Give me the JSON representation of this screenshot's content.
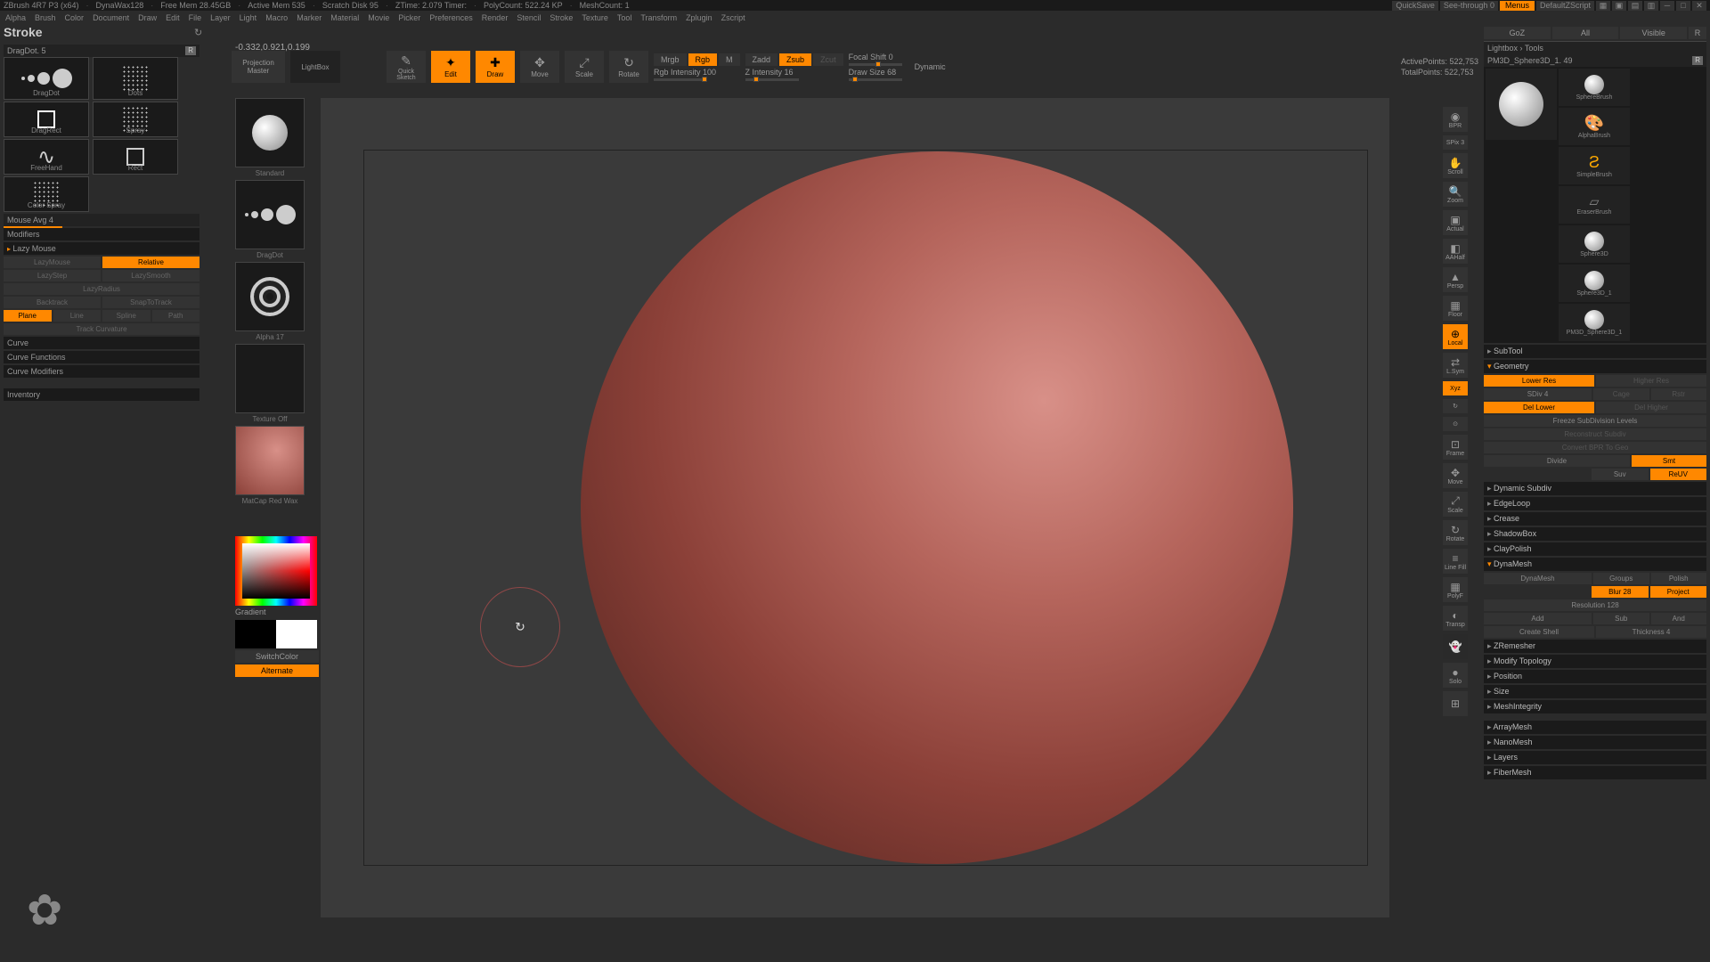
{
  "titlebar": {
    "app": "ZBrush 4R7 P3 (x64)",
    "stats": [
      "DynaWax128",
      "Free Mem 28.45GB",
      "Active Mem 535",
      "Scratch Disk 95",
      "ZTime: 2.079 Timer:",
      "PolyCount: 522.24 KP",
      "MeshCount: 1"
    ],
    "quicksave": "QuickSave",
    "seethrough": "See-through 0",
    "menus": "Menus",
    "layout": "DefaultZScript"
  },
  "menubar": [
    "Alpha",
    "Brush",
    "Color",
    "Document",
    "Draw",
    "Edit",
    "File",
    "Layer",
    "Light",
    "Macro",
    "Marker",
    "Material",
    "Movie",
    "Picker",
    "Preferences",
    "Render",
    "Stencil",
    "Stroke",
    "Texture",
    "Tool",
    "Transform",
    "Zplugin",
    "Zscript"
  ],
  "stroke_title": "Stroke",
  "coord": "-0.332,0.921,0.199",
  "left": {
    "brush_name": "DragDot. 5",
    "r": "R",
    "strokes": [
      {
        "name": "DragDot"
      },
      {
        "name": "Dots"
      },
      {
        "name": "DragRect"
      },
      {
        "name": "Spray"
      },
      {
        "name": "FreeHand"
      },
      {
        "name": "Rect"
      },
      {
        "name": "Color Spray"
      }
    ],
    "mouse_avg": "Mouse Avg 4",
    "modifiers": "Modifiers",
    "lazy_mouse": "Lazy Mouse",
    "lazymouse": "LazyMouse",
    "relative": "Relative",
    "lazystep": "LazyStep",
    "lazysmooth": "LazySmooth",
    "lazyradius": "LazyRadius",
    "backtrack": "Backtrack",
    "snaptotrack": "SnapToTrack",
    "track_opts": [
      "Plane",
      "Line",
      "Spline",
      "Path"
    ],
    "track_curv": "Track Curvature",
    "curve": "Curve",
    "curve_func": "Curve Functions",
    "curve_mod": "Curve Modifiers",
    "inventory": "Inventory"
  },
  "toolbar": {
    "proj_master": "Projection\nMaster",
    "lightbox": "LightBox",
    "quick_sketch": "Quick\nSketch",
    "edit": "Edit",
    "draw": "Draw",
    "move": "Move",
    "scale": "Scale",
    "rotate": "Rotate",
    "mrgb": "Mrgb",
    "rgb": "Rgb",
    "m": "M",
    "rgb_int": "Rgb Intensity 100",
    "zadd": "Zadd",
    "zsub": "Zsub",
    "zcut": "Zcut",
    "z_int": "Z Intensity 16",
    "focal": "Focal Shift 0",
    "draw_size": "Draw Size 68",
    "dynamic": "Dynamic",
    "active_pts": "ActivePoints: 522,753",
    "total_pts": "TotalPoints: 522,753"
  },
  "thumbs": {
    "standard": "Standard",
    "dragdot": "DragDot",
    "alpha": "Alpha 17",
    "texture": "Texture Off",
    "matcap": "MatCap Red Wax",
    "gradient": "Gradient",
    "switch": "SwitchColor",
    "alternate": "Alternate"
  },
  "strip": {
    "bpr": "BPR",
    "spix": "SPix 3",
    "scroll": "Scroll",
    "zoom": "Zoom",
    "actual": "Actual",
    "aahalf": "AAHalf",
    "persp": "Persp",
    "floor": "Floor",
    "local": "Local",
    "lsym": "L.Sym",
    "xyz": "Xyz",
    "frame": "Frame",
    "move": "Move",
    "scale": "Scale",
    "rotate": "Rotate",
    "linefill": "Line Fill",
    "polyf": "PolyF",
    "transp": "Transp",
    "ghost": "Ghost",
    "solo": "Solo",
    "xpose": ""
  },
  "right": {
    "tabs": [
      "GoZ",
      "All",
      "Visible",
      "R"
    ],
    "lightbox_tools": "Lightbox › Tools",
    "current": "PM3D_Sphere3D_1. 49",
    "r": "R",
    "tools": [
      "SphereBrush",
      "AlphaBrush",
      "SimpleBrush",
      "EraserBrush",
      "Sphere3D",
      "Sphere3D_1",
      "PM3D_Sphere3D_1"
    ],
    "subtool": "SubTool",
    "geometry": "Geometry",
    "lower_res": "Lower Res",
    "higher_res": "Higher Res",
    "sdiv": "SDiv 4",
    "cage": "Cage",
    "rstr": "Rstr",
    "del_lower": "Del Lower",
    "del_higher": "Del Higher",
    "freeze": "Freeze SubDivision Levels",
    "reconstruct": "Reconstruct Subdiv",
    "convert": "Convert BPR To Geo",
    "divide": "Divide",
    "smt": "Smt",
    "suv": "Suv",
    "reuv": "ReUV",
    "dynamic_subdiv": "Dynamic Subdiv",
    "edgeloop": "EdgeLoop",
    "crease": "Crease",
    "shadowbox": "ShadowBox",
    "claypolish": "ClayPolish",
    "dynamesh": "DynaMesh",
    "dynamesh_btn": "DynaMesh",
    "groups": "Groups",
    "polish": "Polish",
    "blur": "Blur 28",
    "project": "Project",
    "resolution": "Resolution 128",
    "add": "Add",
    "sub": "Sub",
    "and": "And",
    "create_shell": "Create Shell",
    "thickness": "Thickness 4",
    "zremesher": "ZRemesher",
    "modify_topo": "Modify Topology",
    "position": "Position",
    "size": "Size",
    "mesh_integ": "MeshIntegrity",
    "arraymesh": "ArrayMesh",
    "nanomesh": "NanoMesh",
    "layers": "Layers",
    "fibermesh": "FiberMesh"
  }
}
